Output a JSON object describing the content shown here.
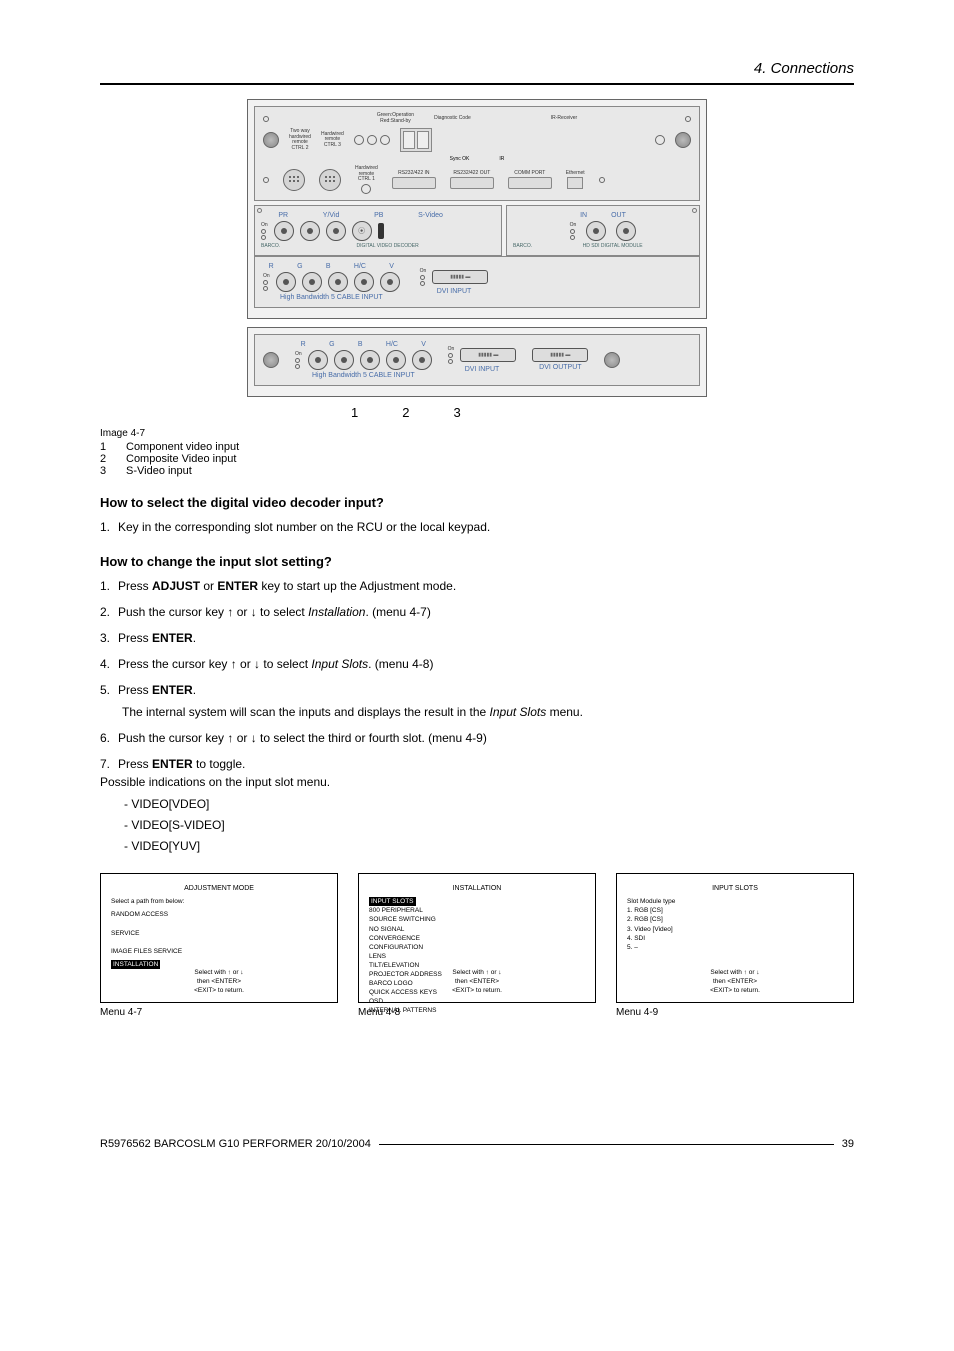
{
  "header": {
    "chapter": "4.  Connections"
  },
  "diagram": {
    "top_panel": {
      "led_label": "Green:Operation\nRed:Stand-by",
      "diag_label": "Diagnostic Code",
      "ir_label": "IR-Receiver",
      "ctrl2_label": "Two way\nhardwired\nremote\nCTRL 2",
      "ctrl3_label": "Hardwired\nremote\nCTRL 3",
      "sync_label": "Sync OK",
      "ir_small": "IR",
      "ctrl1_label": "Hardwired\nremote\nCTRL 1",
      "rs232_in": "RS232/422 IN",
      "rs232_out": "RS232/422 OUT",
      "comm": "COMM PORT",
      "eth": "Ethernet"
    },
    "decoder_panel": {
      "pr": "PR",
      "yvid": "Y/Vid",
      "pb": "PB",
      "sv": "S-Video",
      "on": "On",
      "brand_left": "BARCO.",
      "title_left": "DIGITAL VIDEO DECODER",
      "sdi_in": "IN",
      "sdi_out": "OUT",
      "brand_right": "BARCO.",
      "title_right": "HD SDI DIGITAL MODULE"
    },
    "cable_panel_a": {
      "r": "R",
      "g": "G",
      "b": "B",
      "hc": "H/C",
      "v": "V",
      "on": "On",
      "title_left": "High Bandwidth  5 CABLE INPUT",
      "dvi_in": "DVI INPUT"
    },
    "cable_panel_b": {
      "r": "R",
      "g": "G",
      "b": "B",
      "hc": "H/C",
      "v": "V",
      "on": "On",
      "title_left": "High Bandwidth  5 CABLE INPUT",
      "dvi_in": "DVI INPUT",
      "dvi_out": "DVI OUTPUT"
    },
    "callouts": {
      "n1": "1",
      "n2": "2",
      "n3": "3"
    }
  },
  "image_caption": "Image 4-7",
  "legend": [
    {
      "n": "1",
      "t": "Component video input"
    },
    {
      "n": "2",
      "t": "Composite Video input"
    },
    {
      "n": "3",
      "t": "S-Video input"
    }
  ],
  "section1": {
    "title": "How to select the digital video decoder input?",
    "steps": [
      {
        "n": "1.",
        "t": "Key in the corresponding slot number on the RCU or the local keypad."
      }
    ]
  },
  "section2": {
    "title": "How to change the input slot setting?",
    "steps": [
      {
        "n": "1.",
        "pre": "Press ",
        "b1": "ADJUST",
        "mid": " or ",
        "b2": "ENTER",
        "post": " key to start up the Adjustment mode."
      },
      {
        "n": "2.",
        "pre": "Push the cursor key ↑ or ↓ to select ",
        "i": "Installation",
        "post": ".  (menu 4-7)"
      },
      {
        "n": "3.",
        "pre": "Press ",
        "b1": "ENTER",
        "post": "."
      },
      {
        "n": "4.",
        "pre": "Press the cursor key ↑ or ↓ to select ",
        "i": "Input Slots",
        "post": ".  (menu 4-8)"
      },
      {
        "n": "5.",
        "pre": "Press ",
        "b1": "ENTER",
        "post": "."
      }
    ],
    "sub_after5": "The internal system will scan the inputs and displays the result in the Input Slots menu.",
    "sub_after5_it": "Input Slots",
    "step6": {
      "n": "6.",
      "t": "Push the cursor key ↑ or ↓ to select the third or fourth slot.  (menu 4-9)"
    },
    "step7": {
      "n": "7.",
      "pre": "Press ",
      "b1": "ENTER",
      "post": " to toggle.",
      "sub": "Possible indications on the input slot menu."
    },
    "bullets": [
      "VIDEO[VDEO]",
      "VIDEO[S-VIDEO]",
      "VIDEO[YUV]"
    ]
  },
  "menus": [
    {
      "cap": "Menu 4-7",
      "title": "ADJUSTMENT MODE",
      "hl": "INSTALLATION",
      "body": "RANDOM ACCESS\n\nSERVICE\n\nIMAGE FILES SERVICE",
      "sub": "Select a path from below:",
      "foot": "Select with ↑ or ↓\nthen <ENTER>\n<EXIT> to return."
    },
    {
      "cap": "Menu 4-8",
      "title": "INSTALLATION",
      "hl": "INPUT SLOTS",
      "body": "800 PERIPHERAL\nSOURCE SWITCHING\nNO SIGNAL\nCONVERGENCE\nCONFIGURATION\nLENS\nTILT/ELEVATION\nPROJECTOR ADDRESS\nBARCO LOGO\nQUICK ACCESS KEYS\nOSD\nINTERNAL PATTERNS",
      "foot": "Select with ↑ or ↓\nthen <ENTER>\n<EXIT> to return."
    },
    {
      "cap": "Menu 4-9",
      "title": "INPUT SLOTS",
      "body": "Slot Module type\n1. RGB [CS]\n2. RGB [CS]\n3. Video [Video]\n4. SDI\n5. –",
      "foot": "Select with ↑ or ↓\nthen <ENTER>\n<EXIT> to return."
    }
  ],
  "footer": {
    "doc": "R5976562  BARCOSLM G10 PERFORMER  20/10/2004",
    "page": "39"
  }
}
